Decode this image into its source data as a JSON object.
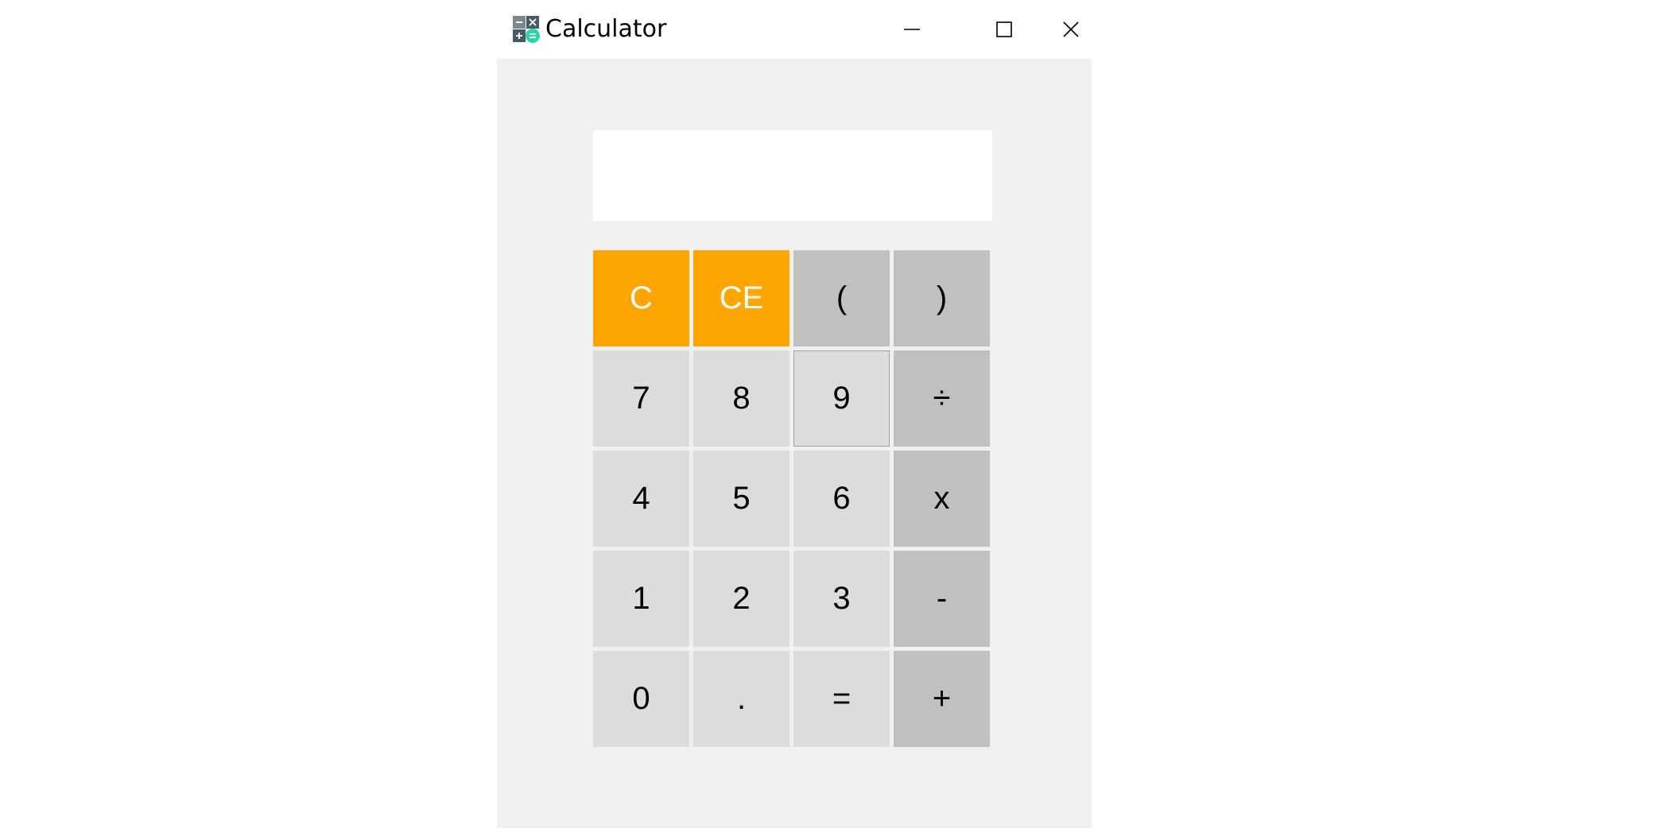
{
  "window": {
    "title": "Calculator",
    "icon": "calculator-app-icon",
    "controls": {
      "minimize_icon": "minimize-icon",
      "maximize_icon": "maximize-icon",
      "close_icon": "close-icon"
    }
  },
  "display": {
    "value": ""
  },
  "colors": {
    "clear_keys": "#ffa500",
    "digit_keys": "#dcdcdc",
    "operator_keys": "#c0c0c0",
    "client_background": "#f0f0f0",
    "display_background": "#ffffff"
  },
  "keypad": {
    "rows": [
      [
        {
          "label": "C",
          "name": "clear-button",
          "kind": "clear"
        },
        {
          "label": "CE",
          "name": "clear-entry-button",
          "kind": "clear"
        },
        {
          "label": "(",
          "name": "open-paren-button",
          "kind": "op"
        },
        {
          "label": ")",
          "name": "close-paren-button",
          "kind": "op"
        }
      ],
      [
        {
          "label": "7",
          "name": "digit-7-button",
          "kind": "digit"
        },
        {
          "label": "8",
          "name": "digit-8-button",
          "kind": "digit"
        },
        {
          "label": "9",
          "name": "digit-9-button",
          "kind": "digit",
          "focused": true
        },
        {
          "label": "÷",
          "name": "divide-button",
          "kind": "op"
        }
      ],
      [
        {
          "label": "4",
          "name": "digit-4-button",
          "kind": "digit"
        },
        {
          "label": "5",
          "name": "digit-5-button",
          "kind": "digit"
        },
        {
          "label": "6",
          "name": "digit-6-button",
          "kind": "digit"
        },
        {
          "label": "x",
          "name": "multiply-button",
          "kind": "op"
        }
      ],
      [
        {
          "label": "1",
          "name": "digit-1-button",
          "kind": "digit"
        },
        {
          "label": "2",
          "name": "digit-2-button",
          "kind": "digit"
        },
        {
          "label": "3",
          "name": "digit-3-button",
          "kind": "digit"
        },
        {
          "label": "-",
          "name": "subtract-button",
          "kind": "op"
        }
      ],
      [
        {
          "label": "0",
          "name": "digit-0-button",
          "kind": "digit"
        },
        {
          "label": ".",
          "name": "decimal-point-button",
          "kind": "digit"
        },
        {
          "label": "=",
          "name": "equals-button",
          "kind": "digit"
        },
        {
          "label": "+",
          "name": "add-button",
          "kind": "op"
        }
      ]
    ]
  }
}
